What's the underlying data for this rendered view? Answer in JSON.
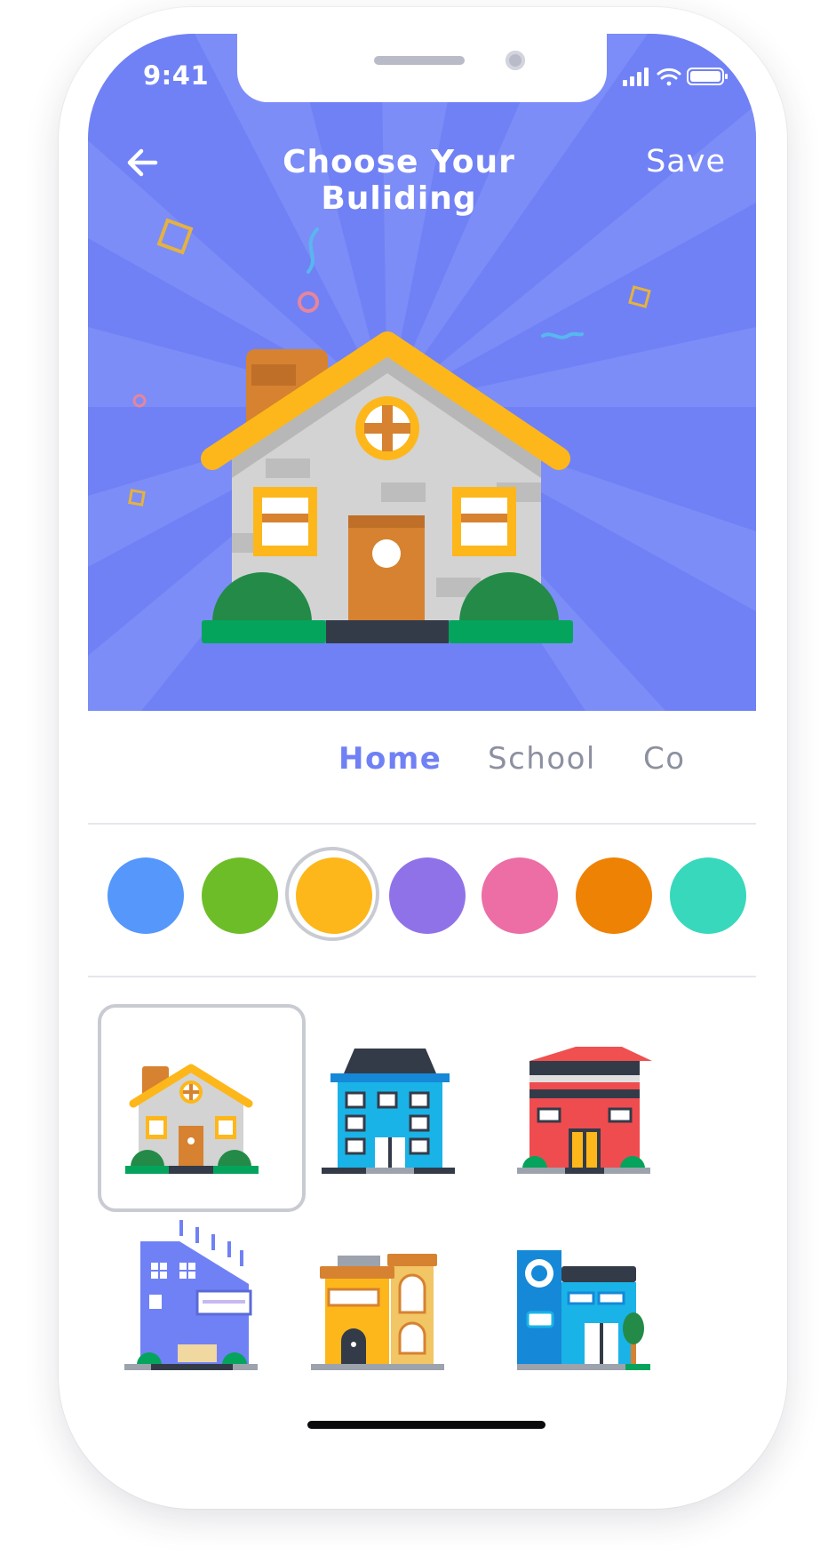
{
  "status_bar": {
    "time": "9:41"
  },
  "header": {
    "title": "Choose Your Buliding",
    "save_label": "Save",
    "back_icon": "arrow-left-icon"
  },
  "tabs": [
    {
      "label": "Home",
      "active": true
    },
    {
      "label": "School",
      "active": false
    },
    {
      "label": "Co",
      "active": false
    }
  ],
  "colors": {
    "accent": "#7081f5",
    "swatches": [
      {
        "name": "blue",
        "hex": "#5597fb",
        "selected": false
      },
      {
        "name": "green",
        "hex": "#6dbd28",
        "selected": false
      },
      {
        "name": "yellow",
        "hex": "#fdb71a",
        "selected": true
      },
      {
        "name": "purple",
        "hex": "#9072e8",
        "selected": false
      },
      {
        "name": "pink",
        "hex": "#ec6ea4",
        "selected": false
      },
      {
        "name": "orange",
        "hex": "#ee8204",
        "selected": false
      },
      {
        "name": "teal",
        "hex": "#37d8bb",
        "selected": false
      }
    ]
  },
  "buildings": [
    {
      "name": "yellow-house",
      "selected": true
    },
    {
      "name": "blue-apartment",
      "selected": false
    },
    {
      "name": "red-shop",
      "selected": false
    },
    {
      "name": "purple-office",
      "selected": false
    },
    {
      "name": "yellow-townhouse",
      "selected": false
    },
    {
      "name": "blue-store",
      "selected": false
    }
  ]
}
